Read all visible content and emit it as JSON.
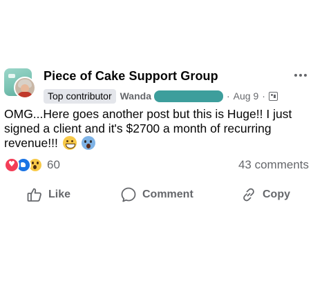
{
  "post": {
    "group_name": "Piece of Cake Support Group",
    "badge": "Top contributor",
    "author": "Wanda",
    "separator": "·",
    "date": "Aug 9",
    "text_line_1": "OMG...Here goes another post but this is Huge!! I just signed a client and it's $2700 a month of recurring revenue!!!",
    "emojis": [
      "grinning-face-emoji",
      "screaming-face-emoji"
    ],
    "reactions_count": "60",
    "reaction_types": [
      "love",
      "like",
      "wow"
    ],
    "comments_count": "43 comments"
  },
  "actions": {
    "like_label": "Like",
    "comment_label": "Comment",
    "copy_label": "Copy"
  },
  "colors": {
    "text": "#050505",
    "muted": "#65676b",
    "badge_bg": "#e4e6eb",
    "redaction": "#3d9e9c",
    "love": "#f33e58",
    "like": "#1b74e4",
    "wow": "#f7c948"
  }
}
